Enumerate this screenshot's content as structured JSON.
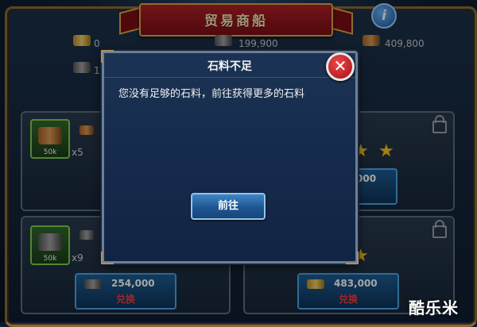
{
  "header": {
    "title": "贸易商船",
    "help_glyph": "i"
  },
  "resources": [
    {
      "icon": "gold-bars-icon",
      "value": "0"
    },
    {
      "icon": "stone-icon",
      "value": "199,900"
    },
    {
      "icon": "wood-log-icon",
      "value": "409,800"
    },
    {
      "icon": "ore-icon",
      "value": "1"
    }
  ],
  "offers": [
    {
      "item_icon": "wood-log-icon",
      "item_amount": "50k",
      "multiplier": "x5"
    },
    {
      "item_icon": "stone-icon",
      "item_amount": "50k",
      "multiplier": "x9",
      "cost": "254,000",
      "action": "兑换"
    },
    {
      "cost": "483,000",
      "action": "兑换"
    },
    {
      "cost": "000"
    }
  ],
  "modal": {
    "title": "石料不足",
    "message": "您没有足够的石料，前往获得更多的石料",
    "confirm_label": "前往",
    "close_glyph": "✕"
  },
  "watermark": "酷乐米",
  "colors": {
    "star": "#f5c423",
    "exchange_text": "#ff3a3a",
    "banner": "#b02028"
  }
}
